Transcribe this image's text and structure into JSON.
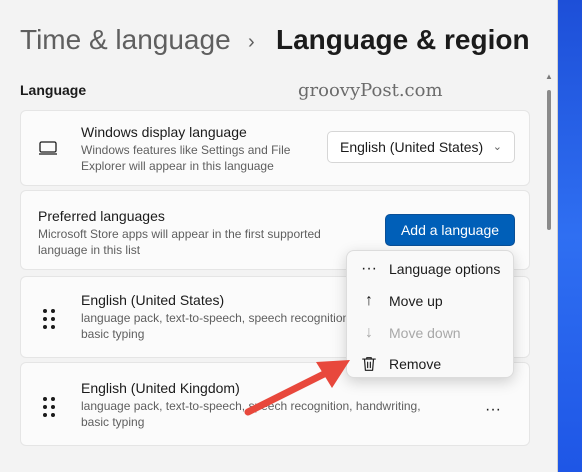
{
  "breadcrumb": {
    "parent": "Time & language",
    "separator": "›",
    "current": "Language & region"
  },
  "watermark": "groovyPost.com",
  "section": {
    "label": "Language"
  },
  "display_language": {
    "title": "Windows display language",
    "description_line1": "Windows features like Settings and File",
    "description_line2": "Explorer will appear in this language",
    "selected": "English (United States)",
    "icon": "monitor-icon"
  },
  "preferred": {
    "title": "Preferred languages",
    "description_line1": "Microsoft Store apps will appear in the first supported",
    "description_line2": "language in this list",
    "add_button": "Add a language"
  },
  "languages": [
    {
      "name": "English (United States)",
      "features_line1": "language pack, text-to-speech, speech recognition,",
      "features_line2": "basic typing"
    },
    {
      "name": "English (United Kingdom)",
      "features_line1": "language pack, text-to-speech, speech recognition, handwriting,",
      "features_line2": "basic typing"
    }
  ],
  "more_icon_glyph": "···",
  "context_menu": {
    "items": [
      {
        "label": "Language options",
        "icon": "more-horizontal-icon",
        "glyph": "···",
        "enabled": true
      },
      {
        "label": "Move up",
        "icon": "arrow-up-icon",
        "glyph": "↑",
        "enabled": true
      },
      {
        "label": "Move down",
        "icon": "arrow-down-icon",
        "glyph": "↓",
        "enabled": false
      },
      {
        "label": "Remove",
        "icon": "trash-icon",
        "glyph": "",
        "enabled": true
      }
    ]
  },
  "colors": {
    "accent": "#005fb8",
    "annotation_arrow": "#e8483c",
    "background": "#f3f3f3"
  }
}
